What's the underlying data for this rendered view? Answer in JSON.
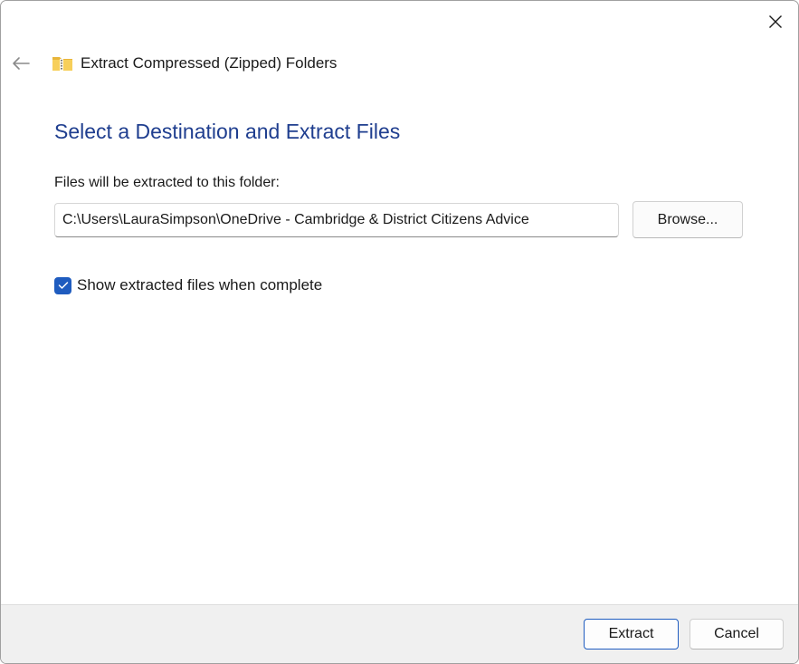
{
  "window": {
    "title": "Extract Compressed (Zipped) Folders",
    "title_icon": "zip-folder-icon"
  },
  "titlebar": {
    "close_icon": "close-icon",
    "back_icon": "back-arrow-icon"
  },
  "main": {
    "heading": "Select a Destination and Extract Files",
    "path_label": "Files will be extracted to this folder:",
    "path_value": "C:\\Users\\LauraSimpson\\OneDrive - Cambridge & District Citizens Advice",
    "browse_label": "Browse...",
    "show_files_checked": true,
    "show_files_label": "Show extracted files when complete"
  },
  "footer": {
    "extract_label": "Extract",
    "cancel_label": "Cancel"
  },
  "colors": {
    "heading": "#1f3e8f",
    "accent": "#1f5cbf",
    "footer_bg": "#f0f0f0"
  }
}
